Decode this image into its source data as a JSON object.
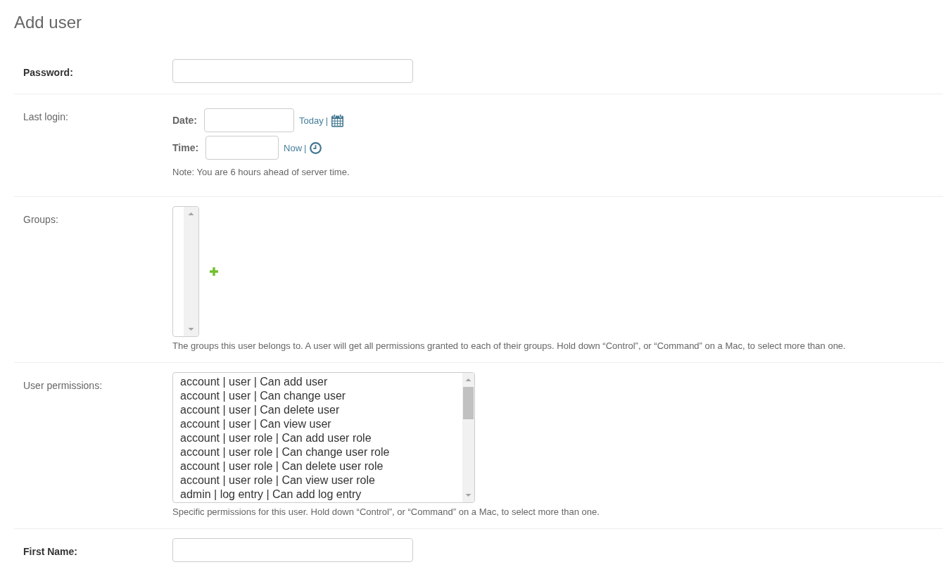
{
  "page": {
    "title": "Add user"
  },
  "fields": [
    {
      "kind": "text",
      "label": "Password:",
      "required": true
    },
    {
      "kind": "datetime",
      "label": "Last login:",
      "required": false,
      "parts": [
        {
          "kind": "date",
          "label": "Date:",
          "shortcut": "Today",
          "separator": "|"
        },
        {
          "kind": "time",
          "label": "Time:",
          "shortcut": "Now",
          "separator": "|"
        }
      ],
      "note": "Note: You are 6 hours ahead of server time."
    },
    {
      "kind": "multiselect",
      "label": "Groups:",
      "required": false,
      "add_related": true,
      "help": "The groups this user belongs to. A user will get all permissions granted to each of their groups. Hold down “Control”, or “Command” on a Mac, to select more than one."
    },
    {
      "kind": "multiselect",
      "label": "User permissions:",
      "required": false,
      "options": [
        {
          "text": "account | user | Can add user",
          "selected": false
        },
        {
          "text": "account | user | Can change user",
          "selected": false
        },
        {
          "text": "account | user | Can delete user",
          "selected": false
        },
        {
          "text": "account | user | Can view user",
          "selected": false
        },
        {
          "text": "account | user role | Can add user role",
          "selected": false
        },
        {
          "text": "account | user role | Can change user role",
          "selected": false
        },
        {
          "text": "account | user role | Can delete user role",
          "selected": false
        },
        {
          "text": "account | user role | Can view user role",
          "selected": false
        },
        {
          "text": "admin | log entry | Can add log entry",
          "selected": false
        }
      ],
      "help": "Specific permissions for this user. Hold down “Control”, or “Command” on a Mac, to select more than one."
    },
    {
      "kind": "text",
      "label": "First Name:",
      "required": true
    }
  ]
}
